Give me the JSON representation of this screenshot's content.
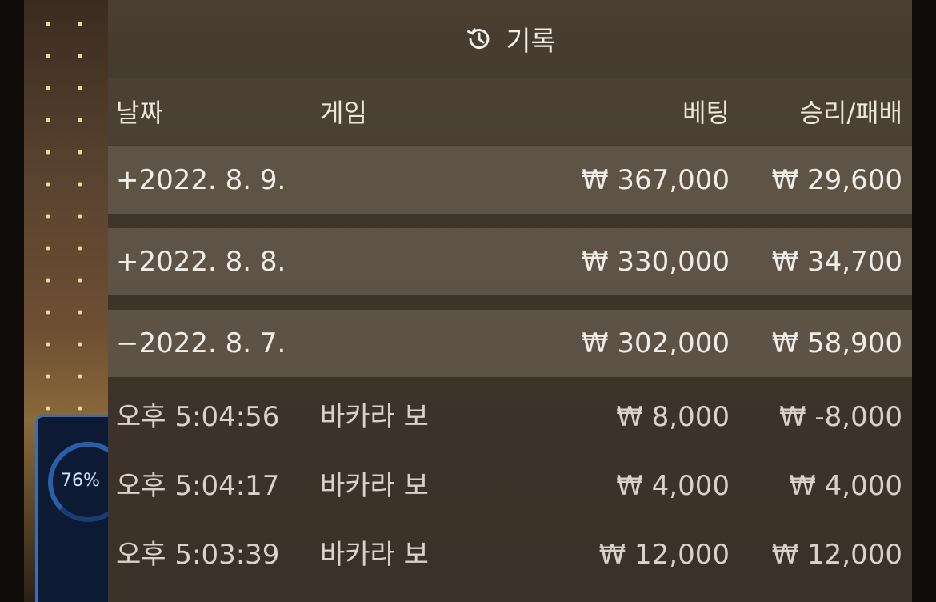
{
  "background": {
    "progress_percent_label": "76%",
    "progress_fraction": 0.76,
    "accent_color": "#3b6fb0"
  },
  "panel": {
    "title": "기록",
    "title_icon": "history-icon"
  },
  "columns": {
    "date": "날짜",
    "game": "게임",
    "bet": "베팅",
    "win_loss": "승리/패배"
  },
  "rows": [
    {
      "type": "date",
      "expand": "+",
      "date": "2022. 8. 9.",
      "game": "",
      "bet": "₩ 367,000",
      "win_loss": "₩ 29,600"
    },
    {
      "type": "date",
      "expand": "+",
      "date": "2022. 8. 8.",
      "game": "",
      "bet": "₩ 330,000",
      "win_loss": "₩ 34,700"
    },
    {
      "type": "date",
      "expand": "−",
      "date": "2022. 8. 7.",
      "game": "",
      "bet": "₩ 302,000",
      "win_loss": "₩ 58,900"
    },
    {
      "type": "detail",
      "expand": "",
      "date": "오후 5:04:56",
      "game": "바카라 보",
      "bet": "₩ 8,000",
      "win_loss": "₩ -8,000"
    },
    {
      "type": "detail",
      "expand": "",
      "date": "오후 5:04:17",
      "game": "바카라 보",
      "bet": "₩ 4,000",
      "win_loss": "₩ 4,000"
    },
    {
      "type": "detail",
      "expand": "",
      "date": "오후 5:03:39",
      "game": "바카라 보",
      "bet": "₩ 12,000",
      "win_loss": "₩ 12,000"
    }
  ]
}
